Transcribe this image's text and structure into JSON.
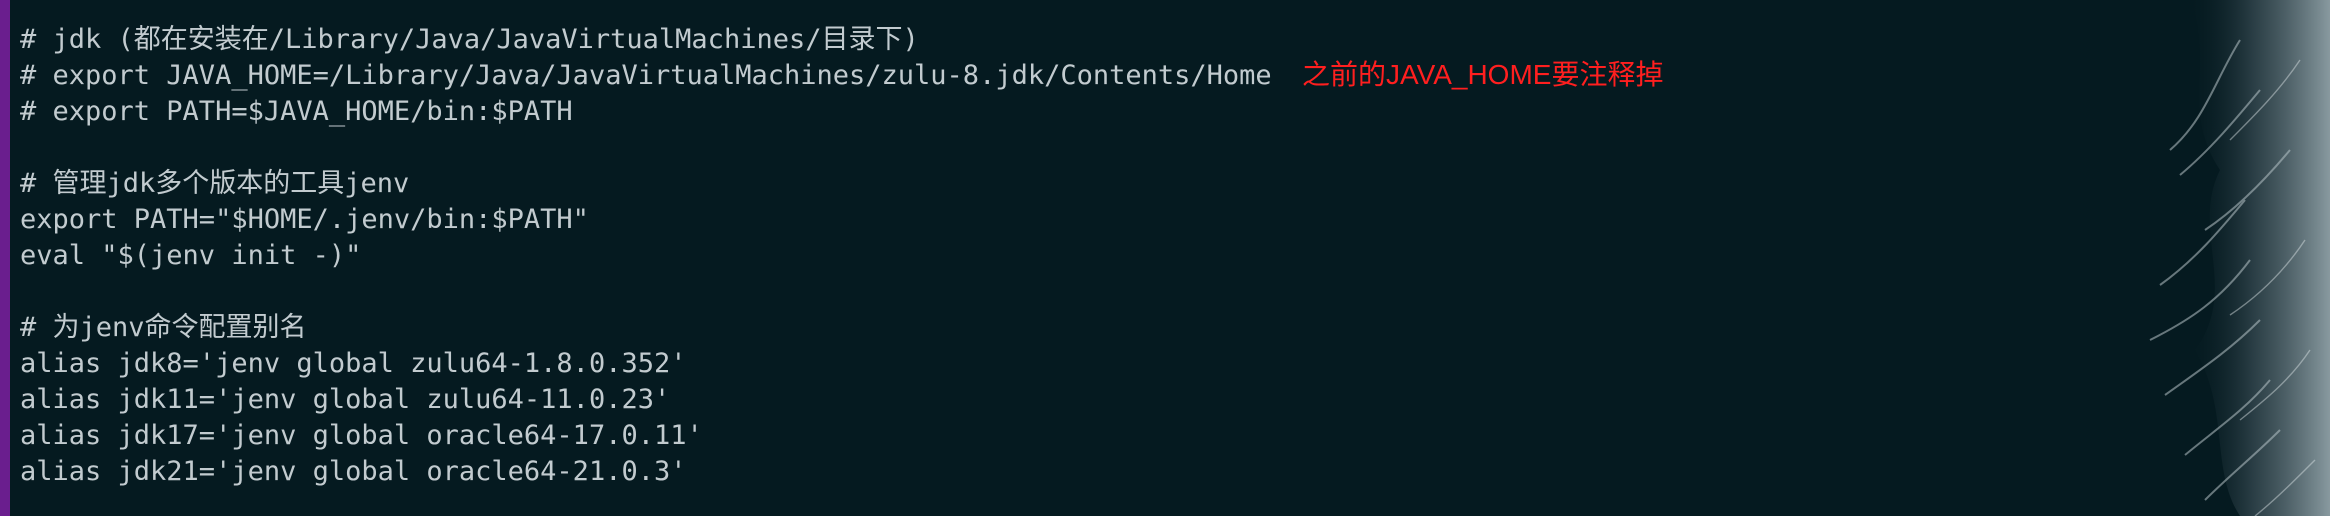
{
  "terminal": {
    "lines": [
      "# jdk (都在安装在/Library/Java/JavaVirtualMachines/目录下)",
      "# export JAVA_HOME=/Library/Java/JavaVirtualMachines/zulu-8.jdk/Contents/Home",
      "# export PATH=$JAVA_HOME/bin:$PATH",
      "",
      "# 管理jdk多个版本的工具jenv",
      "export PATH=\"$HOME/.jenv/bin:$PATH\"",
      "eval \"$(jenv init -)\"",
      "",
      "# 为jenv命令配置别名",
      "alias jdk8='jenv global zulu64-1.8.0.352'",
      "alias jdk11='jenv global zulu64-11.0.23'",
      "alias jdk17='jenv global oracle64-17.0.11'",
      "alias jdk21='jenv global oracle64-21.0.3'"
    ],
    "annotation": "之前的JAVA_HOME要注释掉"
  },
  "colors": {
    "background": "#051a20",
    "text": "#c2cbcf",
    "annotation": "#ff1f1f",
    "left_accent": "#6a1e8e"
  },
  "icons": {
    "background_art": "wolf-fur-icon"
  }
}
